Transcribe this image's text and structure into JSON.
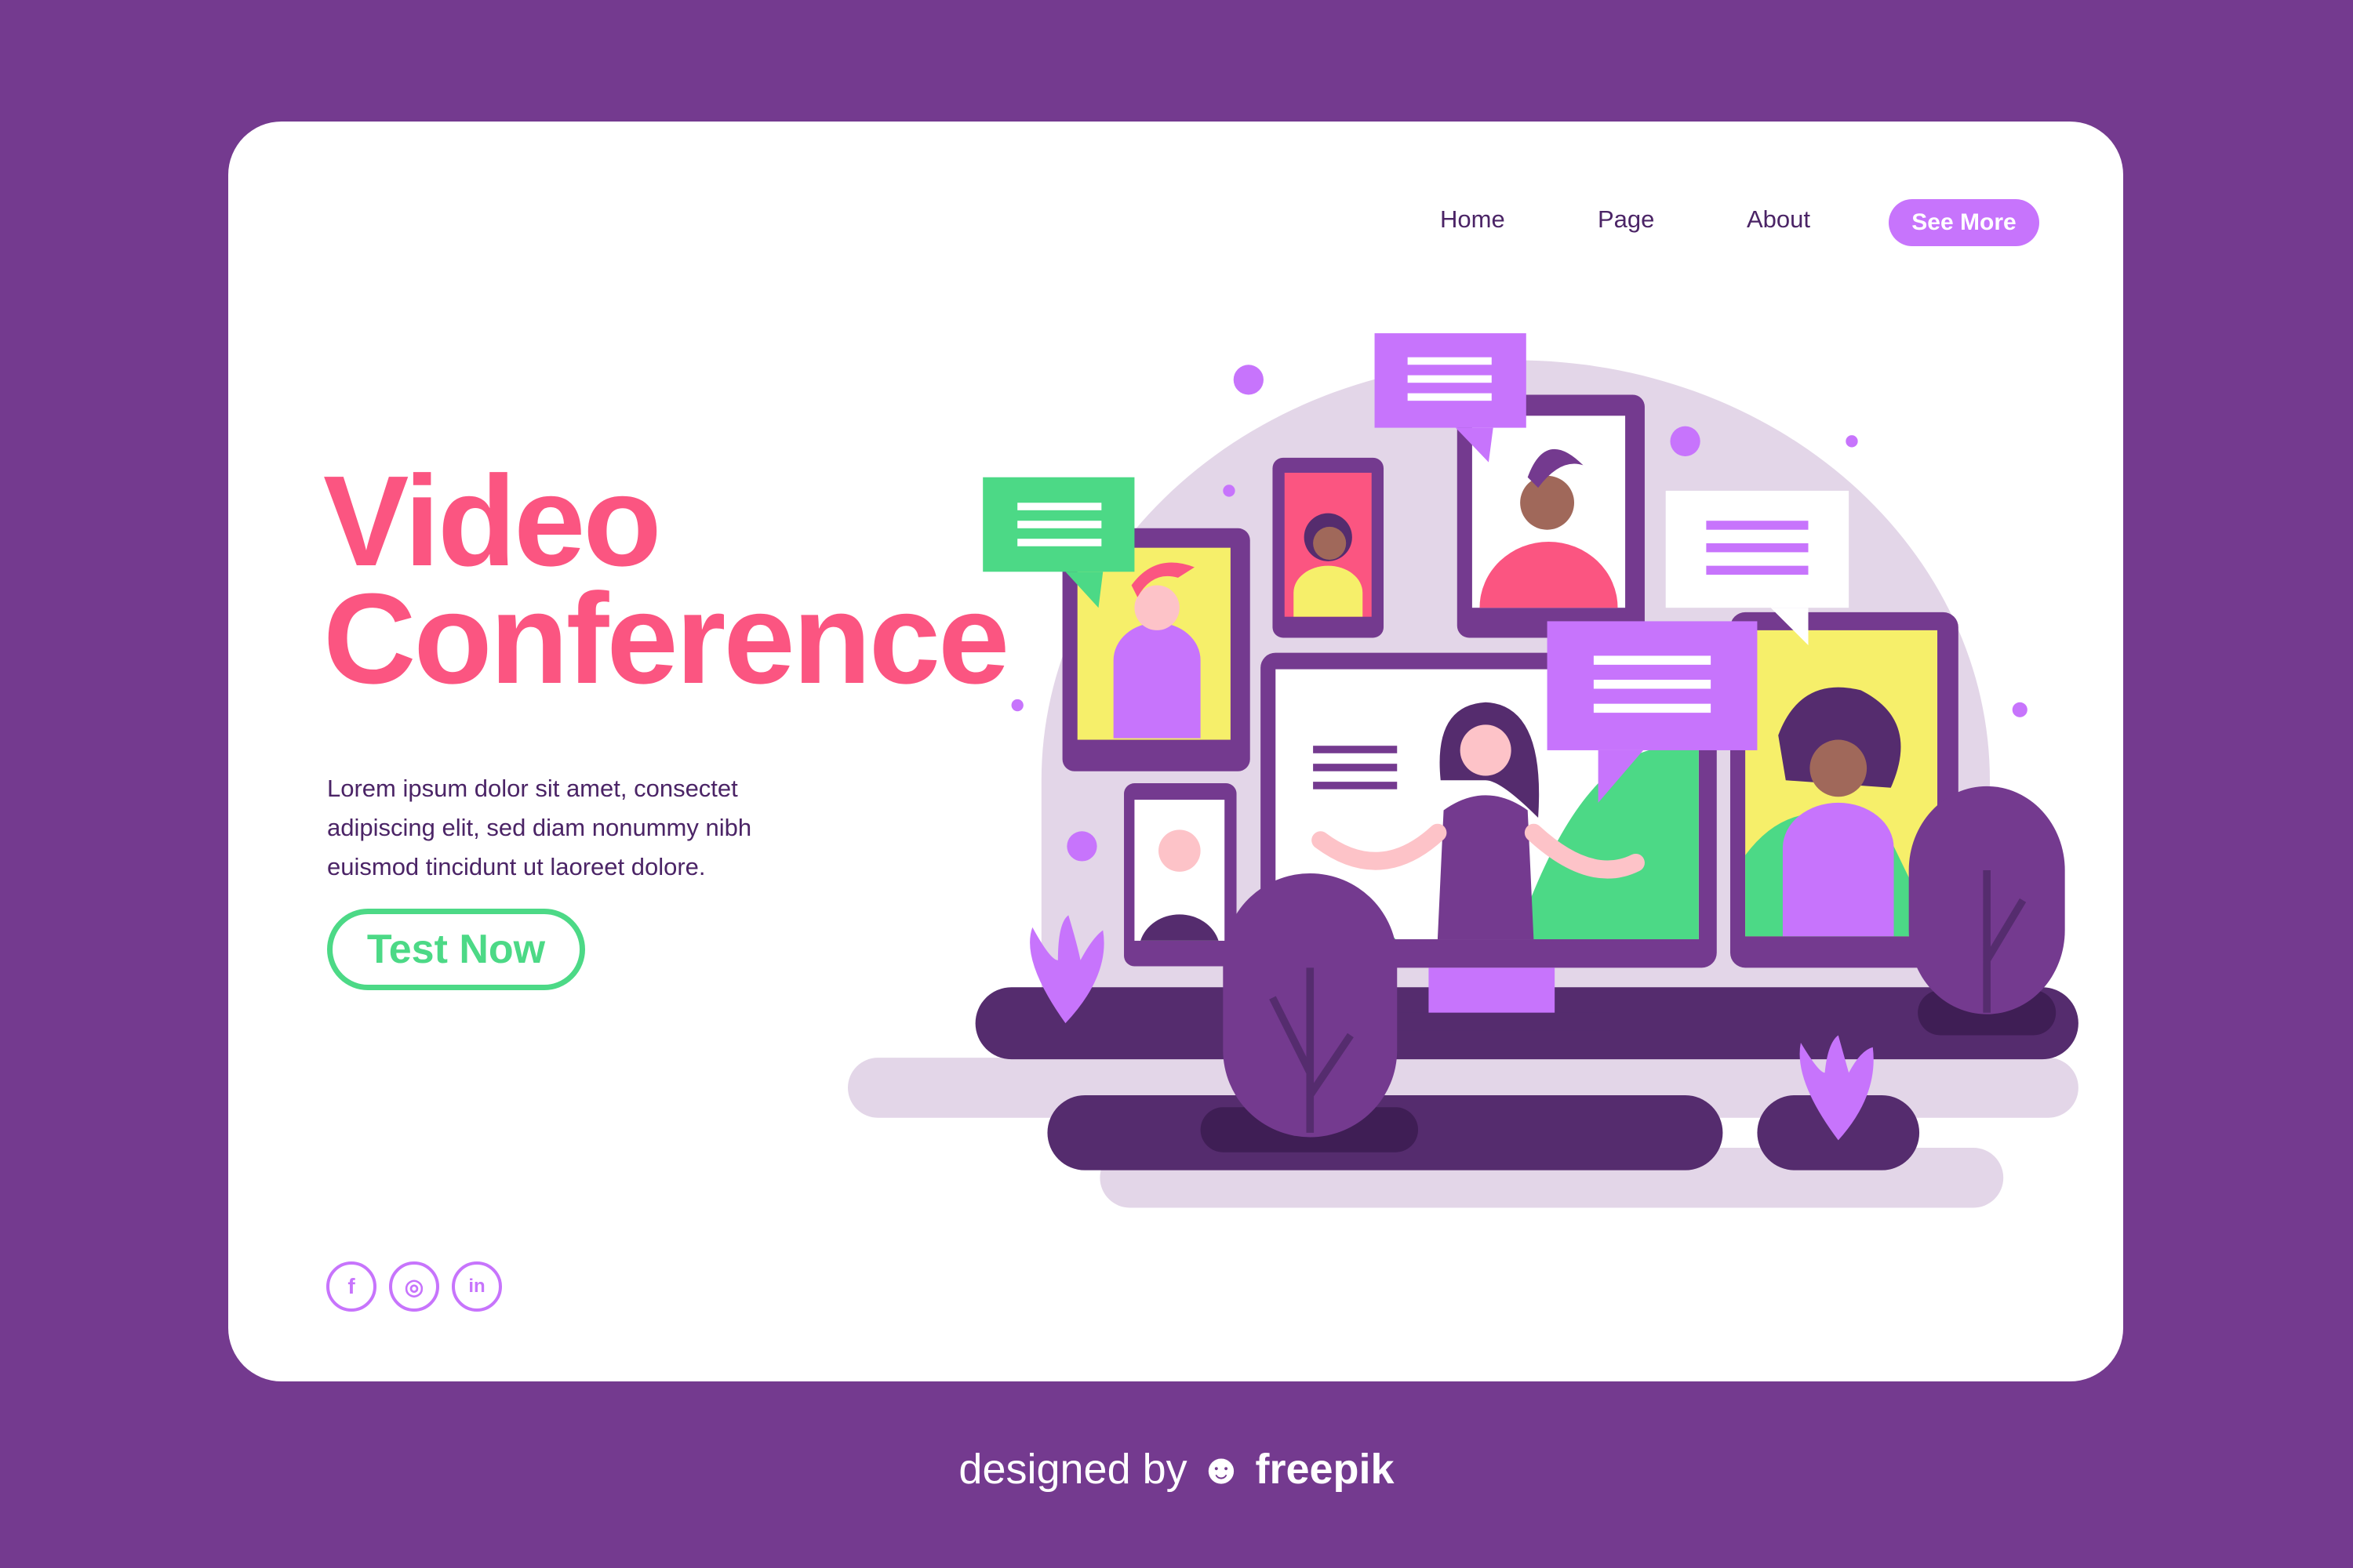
{
  "nav": {
    "items": [
      "Home",
      "Page",
      "About"
    ],
    "cta": "See More"
  },
  "hero": {
    "title_line1": "Video",
    "title_line2": "Conference",
    "description": "Lorem ipsum dolor sit amet, consectet adipiscing elit, sed diam nonummy nibh euismod tincidunt ut laoreet dolore.",
    "button": "Test Now"
  },
  "social": [
    {
      "icon": "facebook-icon",
      "glyph": "f"
    },
    {
      "icon": "instagram-icon",
      "glyph": "◎"
    },
    {
      "icon": "linkedin-icon",
      "glyph": "in"
    }
  ],
  "footer": {
    "prefix": "designed by",
    "brand": "freepik"
  },
  "colors": {
    "background": "#743a8f",
    "title": "#fb5581",
    "accent": "#c774fc",
    "green": "#4cd986",
    "text": "#4b2466"
  }
}
